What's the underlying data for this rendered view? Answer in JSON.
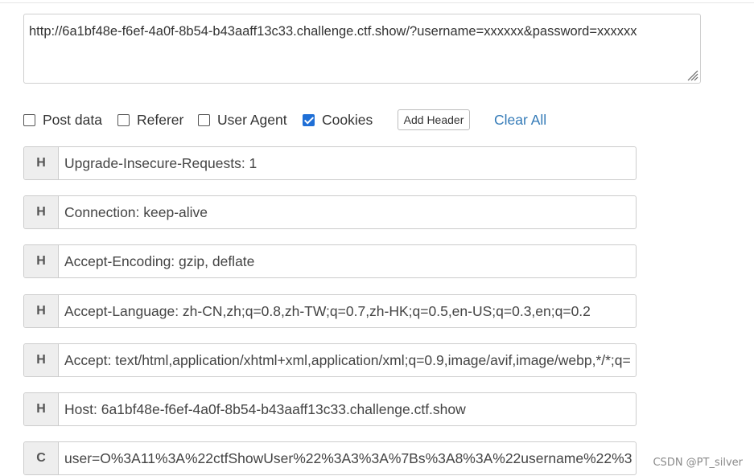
{
  "url_box": {
    "value": "http://6a1bf48e-f6ef-4a0f-8b54-b43aaff13c33.challenge.ctf.show/?username=xxxxxx&password=xxxxxx"
  },
  "options": {
    "post_data": {
      "label": "Post data",
      "checked": false
    },
    "referer": {
      "label": "Referer",
      "checked": false
    },
    "user_agent": {
      "label": "User Agent",
      "checked": false
    },
    "cookies": {
      "label": "Cookies",
      "checked": true
    },
    "add_header_label": "Add Header",
    "clear_all_label": "Clear All"
  },
  "headers": [
    {
      "tag": "H",
      "value": "Upgrade-Insecure-Requests: 1"
    },
    {
      "tag": "H",
      "value": "Connection: keep-alive"
    },
    {
      "tag": "H",
      "value": "Accept-Encoding: gzip, deflate"
    },
    {
      "tag": "H",
      "value": "Accept-Language: zh-CN,zh;q=0.8,zh-TW;q=0.7,zh-HK;q=0.5,en-US;q=0.3,en;q=0.2"
    },
    {
      "tag": "H",
      "value": "Accept: text/html,application/xhtml+xml,application/xml;q=0.9,image/avif,image/webp,*/*;q="
    },
    {
      "tag": "H",
      "value": "Host: 6a1bf48e-f6ef-4a0f-8b54-b43aaff13c33.challenge.ctf.show"
    },
    {
      "tag": "C",
      "value": "user=O%3A11%3A%22ctfShowUser%22%3A3%3A%7Bs%3A8%3A%22username%22%3"
    }
  ],
  "watermark": "CSDN @PT_silver",
  "colors": {
    "link": "#337ab7",
    "checkbox_checked": "#1f6fd6"
  }
}
